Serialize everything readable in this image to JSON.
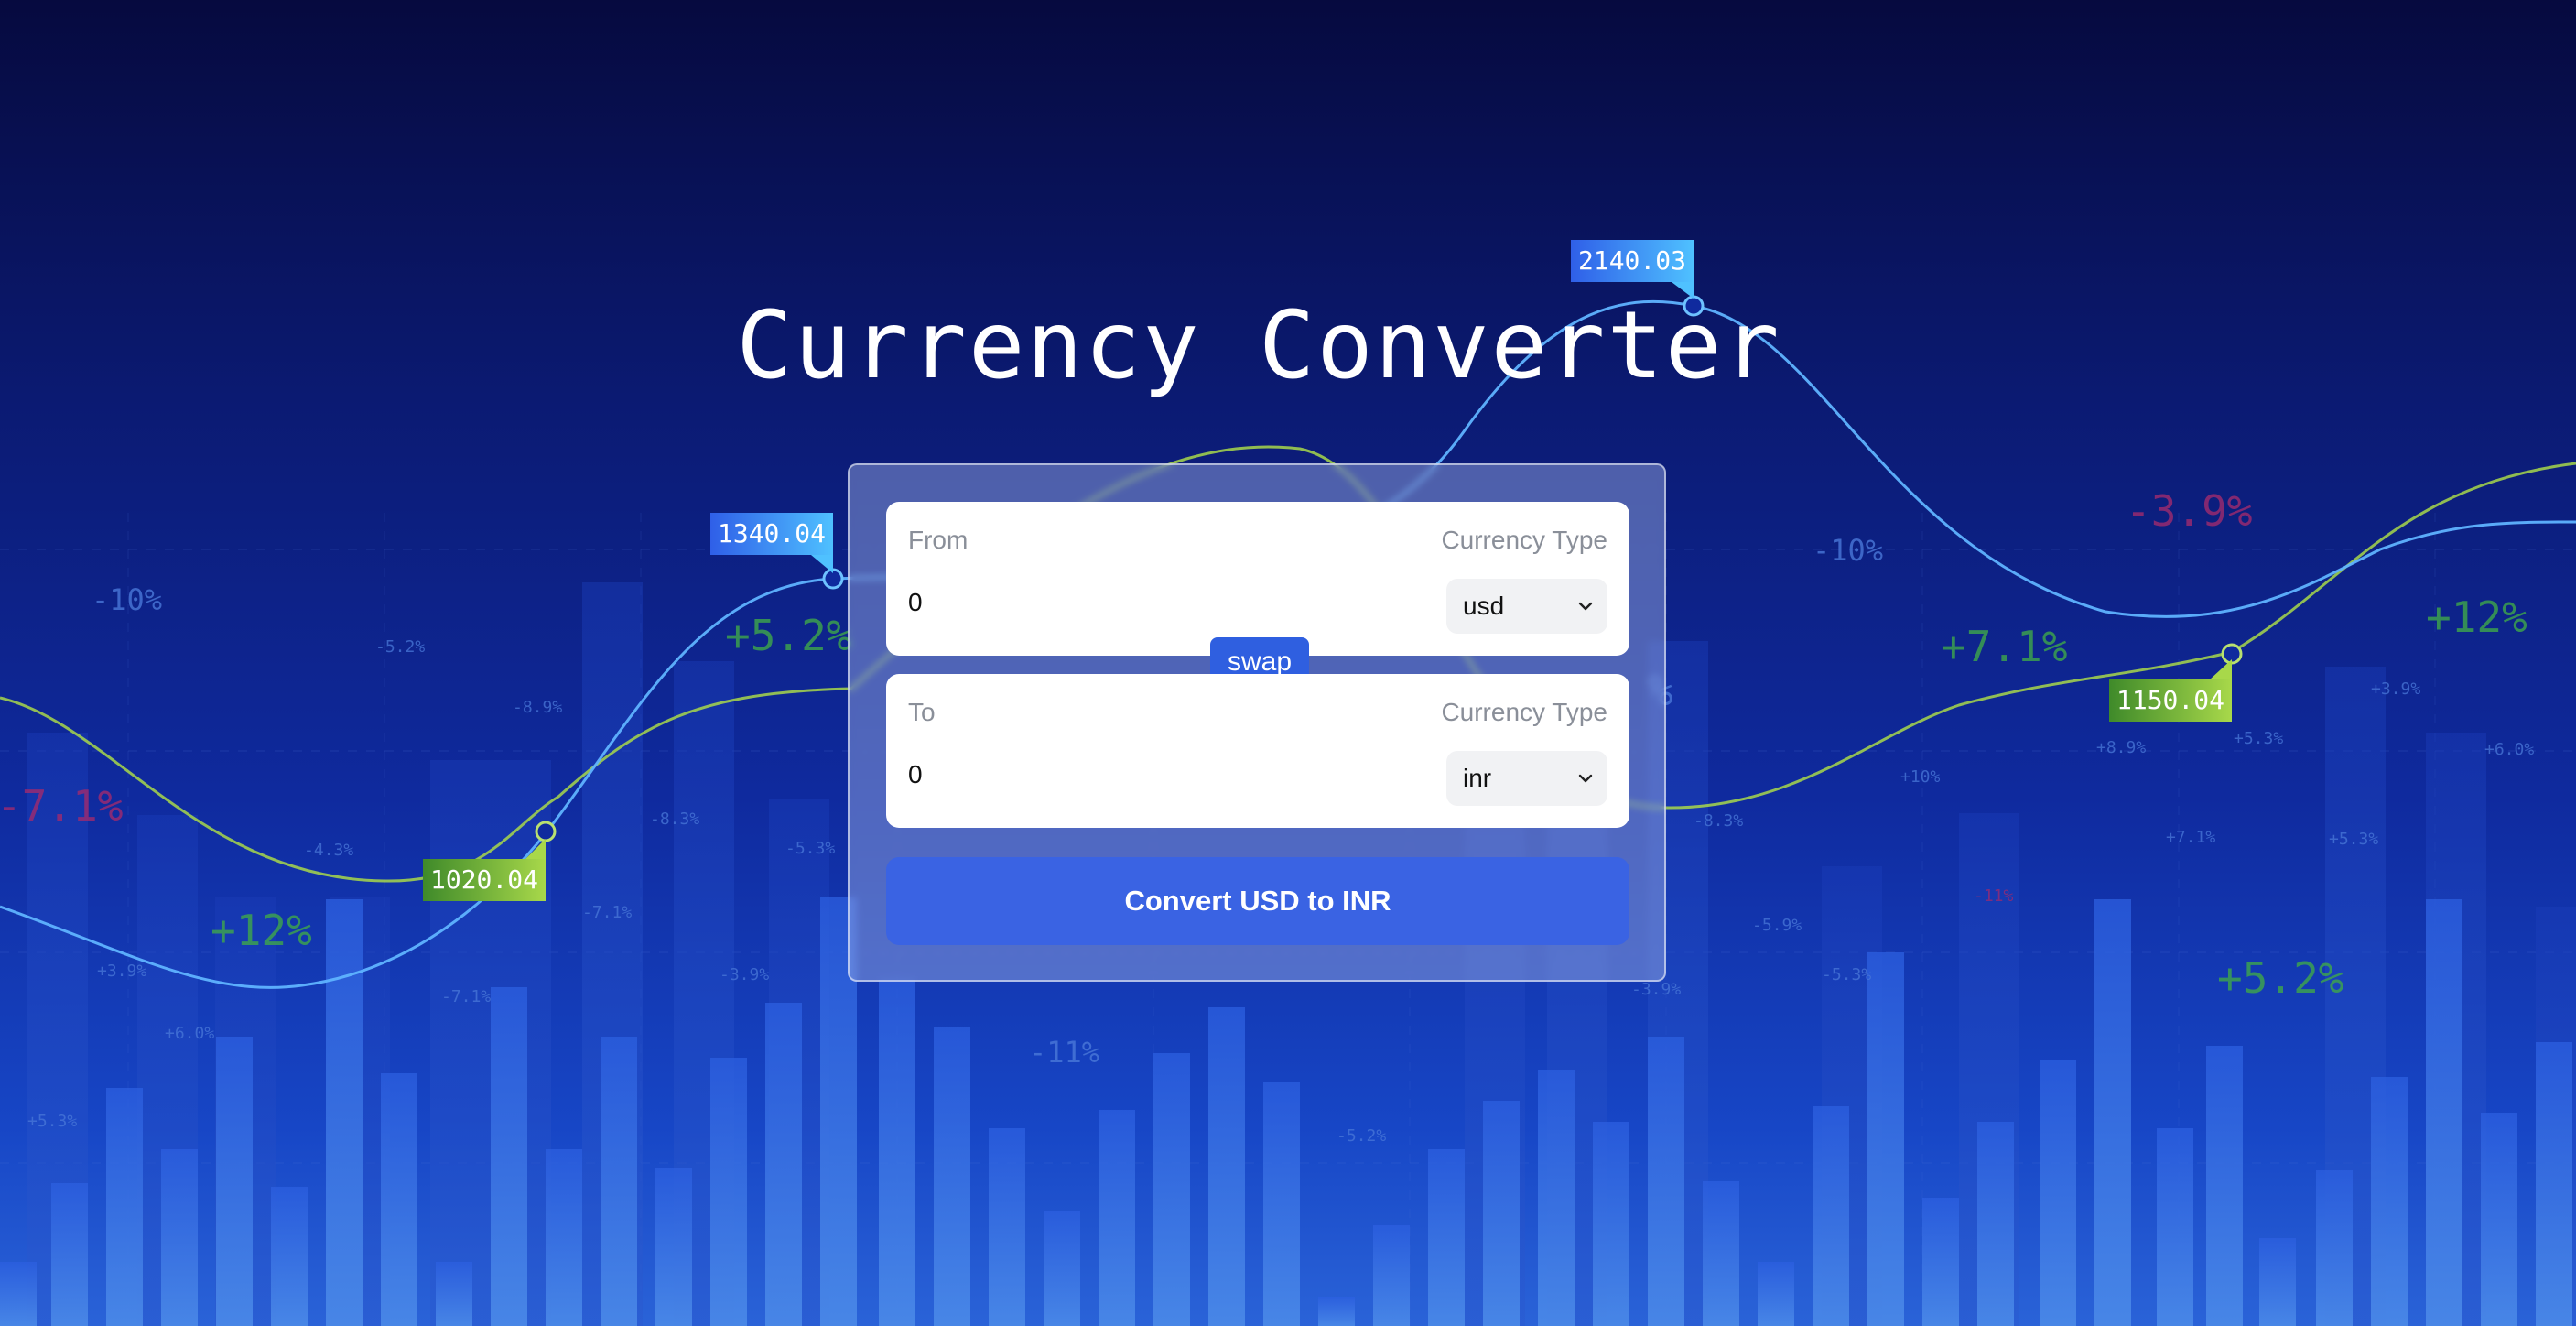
{
  "header": {
    "title": "Currency Converter"
  },
  "converter": {
    "from": {
      "label": "From",
      "type_label": "Currency Type",
      "amount": "0",
      "currency": "usd"
    },
    "to": {
      "label": "To",
      "type_label": "Currency Type",
      "amount": "0",
      "currency": "inr"
    },
    "swap_label": "swap",
    "convert_label": "Convert USD to INR"
  },
  "background": {
    "value_badges": [
      "1340.04",
      "1020.04",
      "2140.03",
      "1150.04"
    ],
    "percent_labels_large": [
      "-10%",
      "+5.2%",
      "-7.1%",
      "+12%",
      "-3.9%",
      "-10%",
      "+7.1%",
      "+12%",
      "+5.2%",
      "-11%",
      "%"
    ],
    "percent_labels_small": [
      "-5.2%",
      "-8.9%",
      "-8.3%",
      "-4.3%",
      "-5.3%",
      "-7.1%",
      "+3.9%",
      "+6.0%",
      "+5.3%",
      "-7.1%",
      "-3.9%",
      "-5.2%",
      "-8.3%",
      "-5.9%",
      "-5.3%",
      "-3.9%",
      "+10%",
      "+8.9%",
      "+5.3%",
      "+7.1%",
      "+5.3%",
      "+3.9%",
      "+6.0%",
      "-11%"
    ],
    "colors": {
      "positive": "#3fa84a",
      "negative": "#a02a6e",
      "neutral": "#4a78d8",
      "blue_line": "#5fb3ff",
      "green_line": "#a8d84a"
    }
  }
}
